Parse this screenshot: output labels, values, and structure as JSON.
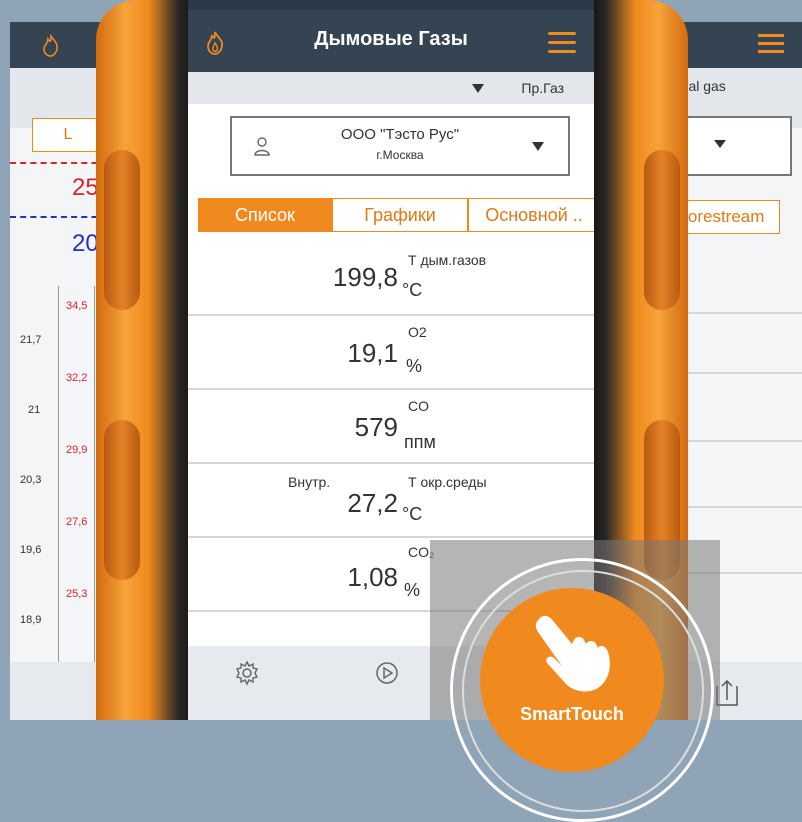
{
  "colors": {
    "accent": "#f08a1e",
    "header": "#344453",
    "left_red": "#d7262a",
    "left_blue": "#2330c8"
  },
  "app": {
    "title": "Дымовые Газы",
    "fuel": "Пр.Газ"
  },
  "customer": {
    "name": "ООО \"Тэсто Рус\"",
    "city": "г.Москва"
  },
  "tabs": [
    {
      "label": "Список",
      "active": true
    },
    {
      "label": "Графики",
      "active": false
    },
    {
      "label": "Основной ..",
      "active": false
    }
  ],
  "readings": [
    {
      "label": "Т дым.газов",
      "value": "199,8",
      "unit": "°C",
      "prefix": ""
    },
    {
      "label": "O2",
      "value": "19,1",
      "unit": "%",
      "prefix": ""
    },
    {
      "label": "CO",
      "value": "579",
      "unit": "ппм",
      "prefix": ""
    },
    {
      "label": "Т окр.среды",
      "value": "27,2",
      "unit": "°C",
      "prefix": "Внутр."
    },
    {
      "label": "CO₂",
      "value": "1,08",
      "unit": "%",
      "prefix": ""
    }
  ],
  "bottom": {
    "icons": [
      "gear-icon",
      "play-icon"
    ]
  },
  "left_panel": {
    "button": "L",
    "val_red": "25",
    "val_blue": "20",
    "axis_left": [
      "21,7",
      "21",
      "20,3",
      "19,6",
      "18,9"
    ],
    "axis_right": [
      "34,5",
      "32,2",
      "29,9",
      "27,6",
      "25,3"
    ]
  },
  "right_panel": {
    "fuel_partial": "ural gas",
    "button": "Corestream"
  },
  "smarttouch": {
    "label": "SmartTouch"
  }
}
